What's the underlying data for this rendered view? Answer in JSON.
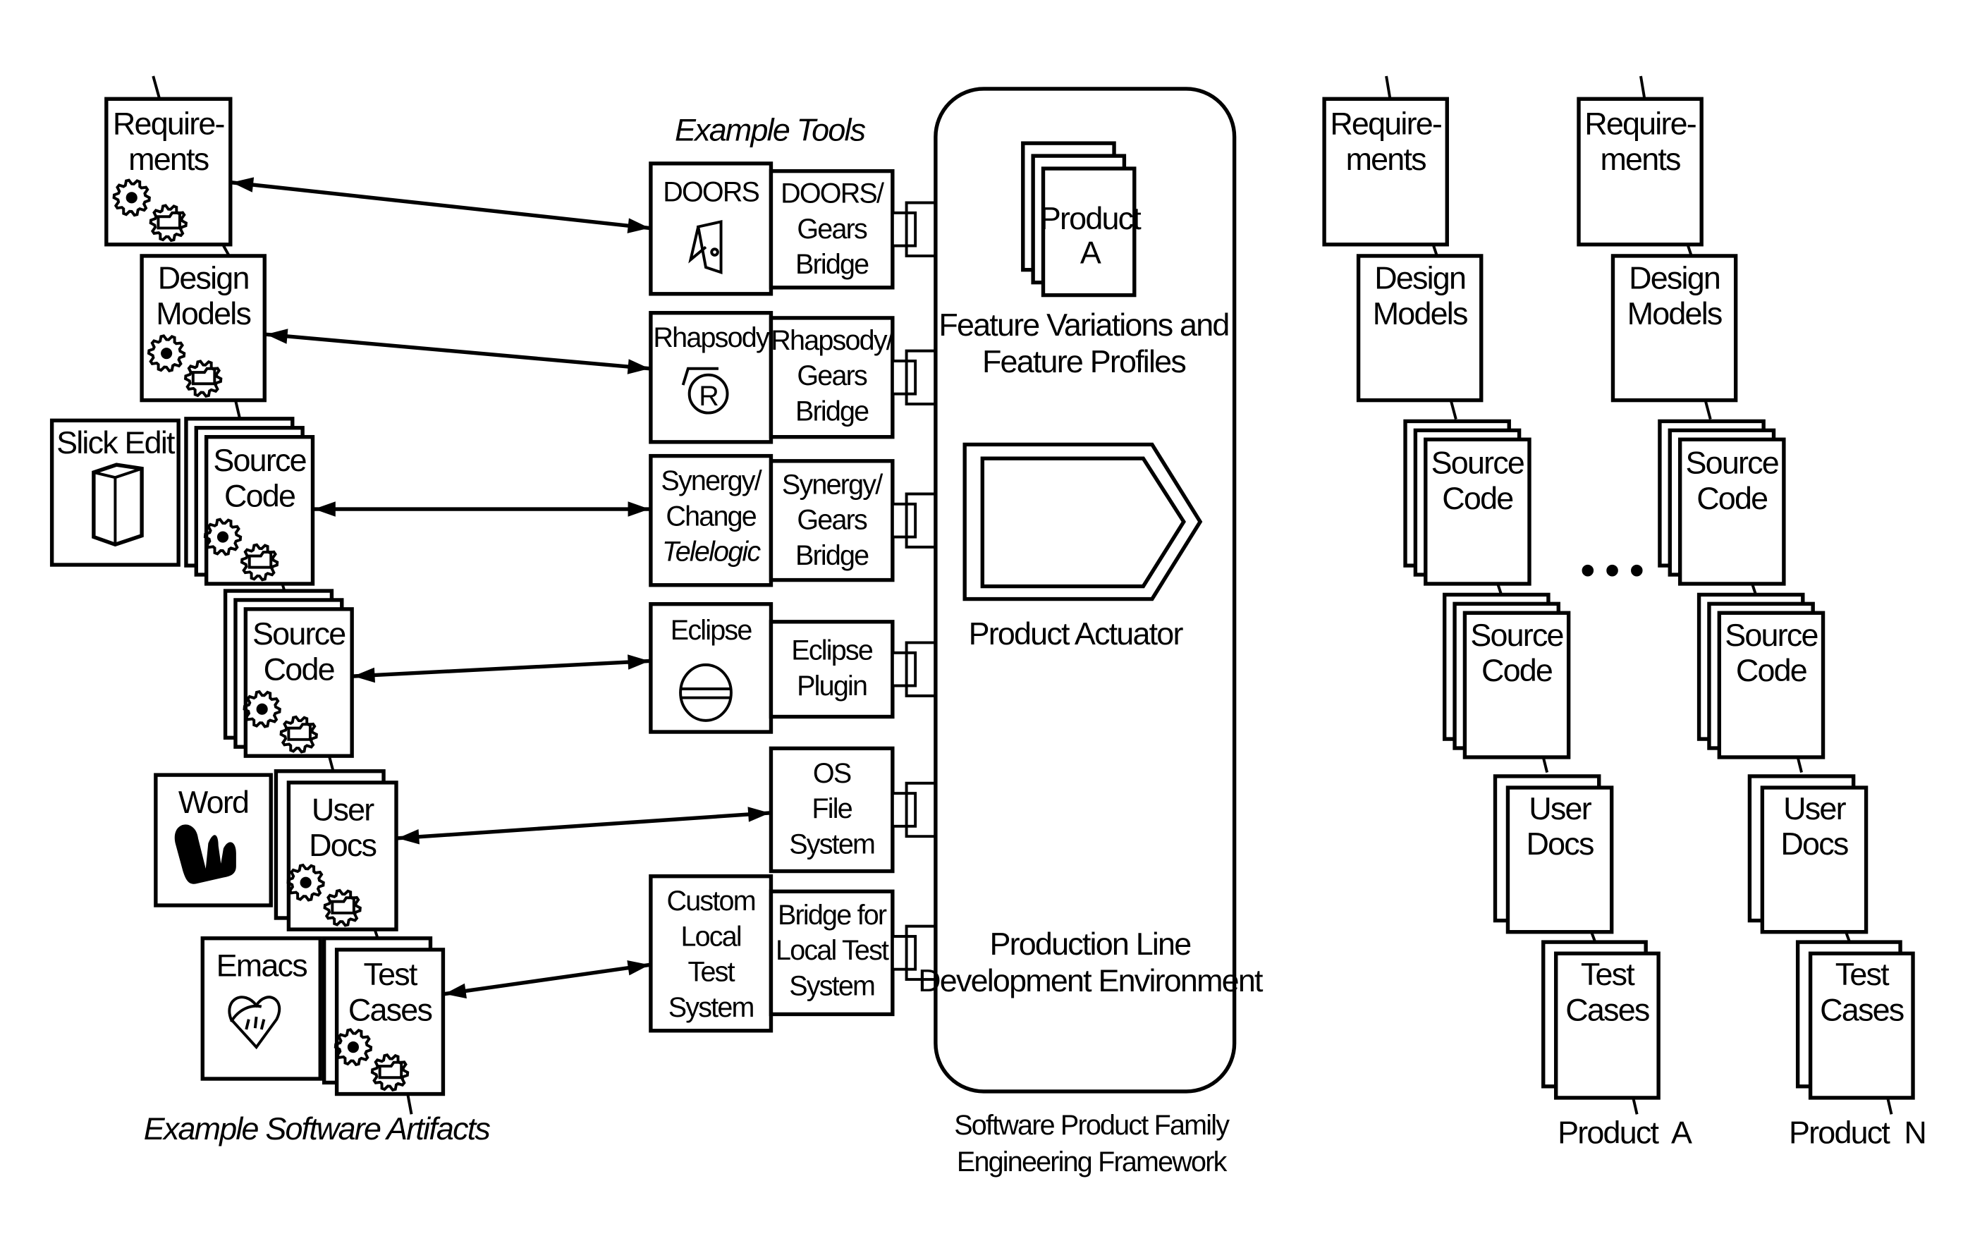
{
  "diagram": {
    "colors": {
      "ink": "#000000",
      "paper": "#ffffff"
    },
    "captions": {
      "example_tools": "Example Tools",
      "example_artifacts": "Example Software Artifacts",
      "framework": [
        "Software Product Family",
        "Engineering Framework"
      ]
    },
    "framework": {
      "product_stack": [
        "Product",
        "A"
      ],
      "feature_label": [
        "Feature Variations and",
        "Feature Profiles"
      ],
      "actuator_label": "Product Actuator",
      "environment_label": [
        "Production Line",
        "Development Environment"
      ]
    },
    "artifacts": [
      {
        "id": "requirements",
        "lines": [
          "Require-",
          "ments"
        ],
        "layers": 1,
        "gears": true
      },
      {
        "id": "design-models",
        "lines": [
          "Design",
          "Models"
        ],
        "layers": 1,
        "gears": true
      },
      {
        "id": "source-code-1",
        "lines": [
          "Source",
          "Code"
        ],
        "layers": 3,
        "gears": true
      },
      {
        "id": "source-code-2",
        "lines": [
          "Source",
          "Code"
        ],
        "layers": 3,
        "gears": true
      },
      {
        "id": "user-docs",
        "lines": [
          "User",
          "Docs"
        ],
        "layers": 2,
        "gears": true
      },
      {
        "id": "test-cases",
        "lines": [
          "Test",
          "Cases"
        ],
        "layers": 2,
        "gears": true
      }
    ],
    "editors": [
      {
        "id": "slick-edit",
        "label": "Slick Edit",
        "icon": "book-icon"
      },
      {
        "id": "word",
        "label": "Word",
        "icon": "word-logo-icon"
      },
      {
        "id": "emacs",
        "label": "Emacs",
        "icon": "emacs-logo-icon"
      }
    ],
    "tools": [
      {
        "id": "doors",
        "tool_lines": [
          "DOORS"
        ],
        "icon": "door-icon",
        "bridge_lines": [
          "DOORS/",
          "Gears",
          "Bridge"
        ]
      },
      {
        "id": "rhapsody",
        "tool_lines": [
          "Rhapsody"
        ],
        "icon": "registered-icon",
        "bridge_lines": [
          "Rhapsody/",
          "Gears",
          "Bridge"
        ]
      },
      {
        "id": "synergy",
        "tool_lines": [
          "Synergy/",
          "Change",
          "Telelogic"
        ],
        "icon": null,
        "bridge_lines": [
          "Synergy/",
          "Gears",
          "Bridge"
        ]
      },
      {
        "id": "eclipse",
        "tool_lines": [
          "Eclipse"
        ],
        "icon": "eclipse-icon",
        "bridge_lines": [
          "Eclipse",
          "Plugin"
        ]
      },
      {
        "id": "os-file-system",
        "tool_lines": [],
        "icon": null,
        "bridge_lines": [
          "OS",
          "File",
          "System"
        ]
      },
      {
        "id": "custom-test",
        "tool_lines": [
          "Custom",
          "Local",
          "Test",
          "System"
        ],
        "icon": null,
        "bridge_lines": [
          "Bridge for",
          "Local Test",
          "System"
        ]
      }
    ],
    "products": [
      {
        "label": "Product  A",
        "items": [
          {
            "lines": [
              "Require-",
              "ments"
            ],
            "layers": 1
          },
          {
            "lines": [
              "Design",
              "Models"
            ],
            "layers": 1
          },
          {
            "lines": [
              "Source",
              "Code"
            ],
            "layers": 3
          },
          {
            "lines": [
              "Source",
              "Code"
            ],
            "layers": 3
          },
          {
            "lines": [
              "User",
              "Docs"
            ],
            "layers": 2
          },
          {
            "lines": [
              "Test",
              "Cases"
            ],
            "layers": 2
          }
        ]
      },
      {
        "label": "Product  N",
        "items": [
          {
            "lines": [
              "Require-",
              "ments"
            ],
            "layers": 1
          },
          {
            "lines": [
              "Design",
              "Models"
            ],
            "layers": 1
          },
          {
            "lines": [
              "Source",
              "Code"
            ],
            "layers": 3
          },
          {
            "lines": [
              "Source",
              "Code"
            ],
            "layers": 3
          },
          {
            "lines": [
              "User",
              "Docs"
            ],
            "layers": 2
          },
          {
            "lines": [
              "Test",
              "Cases"
            ],
            "layers": 2
          }
        ]
      }
    ],
    "ellipsis": "• • •"
  }
}
